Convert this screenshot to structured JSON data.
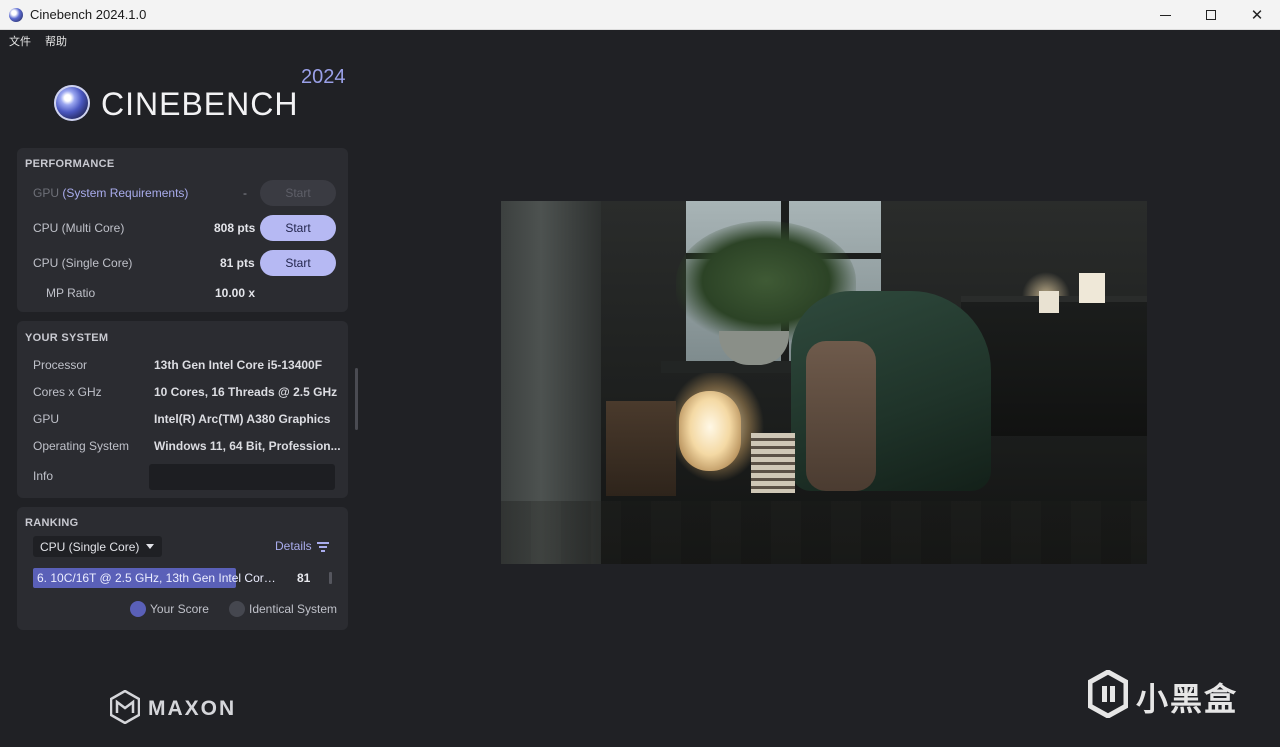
{
  "window": {
    "title": "Cinebench 2024.1.0",
    "controls": {
      "minimize": "minimize",
      "maximize": "maximize",
      "close": "✕"
    }
  },
  "menu": {
    "items": [
      "文件",
      "帮助"
    ]
  },
  "logo": {
    "name": "CINEBENCH",
    "year": "2024"
  },
  "performance": {
    "title": "PERFORMANCE",
    "gpu": {
      "label_prefix": "GPU",
      "label_link": "(System Requirements)",
      "value": "-",
      "button": "Start"
    },
    "cpu_multi": {
      "label": "CPU (Multi Core)",
      "value": "808 pts",
      "button": "Start"
    },
    "cpu_single": {
      "label": "CPU (Single Core)",
      "value": "81 pts",
      "button": "Start"
    },
    "mp_ratio": {
      "label": "MP Ratio",
      "value": "10.00 x"
    }
  },
  "system": {
    "title": "YOUR SYSTEM",
    "rows": [
      {
        "label": "Processor",
        "value": "13th Gen Intel Core i5-13400F"
      },
      {
        "label": "Cores x GHz",
        "value": "10 Cores, 16 Threads @ 2.5 GHz"
      },
      {
        "label": "GPU",
        "value": "Intel(R) Arc(TM) A380 Graphics"
      },
      {
        "label": "Operating System",
        "value": "Windows 11, 64 Bit, Profession..."
      }
    ],
    "info_label": "Info",
    "info_value": ""
  },
  "ranking": {
    "title": "RANKING",
    "selected": "CPU (Single Core)",
    "details": "Details",
    "entries": [
      {
        "text": "6. 10C/16T @ 2.5 GHz, 13th Gen Intel Core i...",
        "score": "81",
        "bar_fraction": 0.7
      }
    ],
    "legend": [
      {
        "label": "Your Score",
        "color": "#5a60b8"
      },
      {
        "label": "Identical System",
        "color": "#45474f"
      }
    ]
  },
  "footer": {
    "brand": "MAXON"
  },
  "watermark": {
    "text": "小黑盒"
  },
  "colors": {
    "accent": "#b6b9f3",
    "panel": "#2b2c31",
    "background": "#202125",
    "link": "#a9acec"
  }
}
